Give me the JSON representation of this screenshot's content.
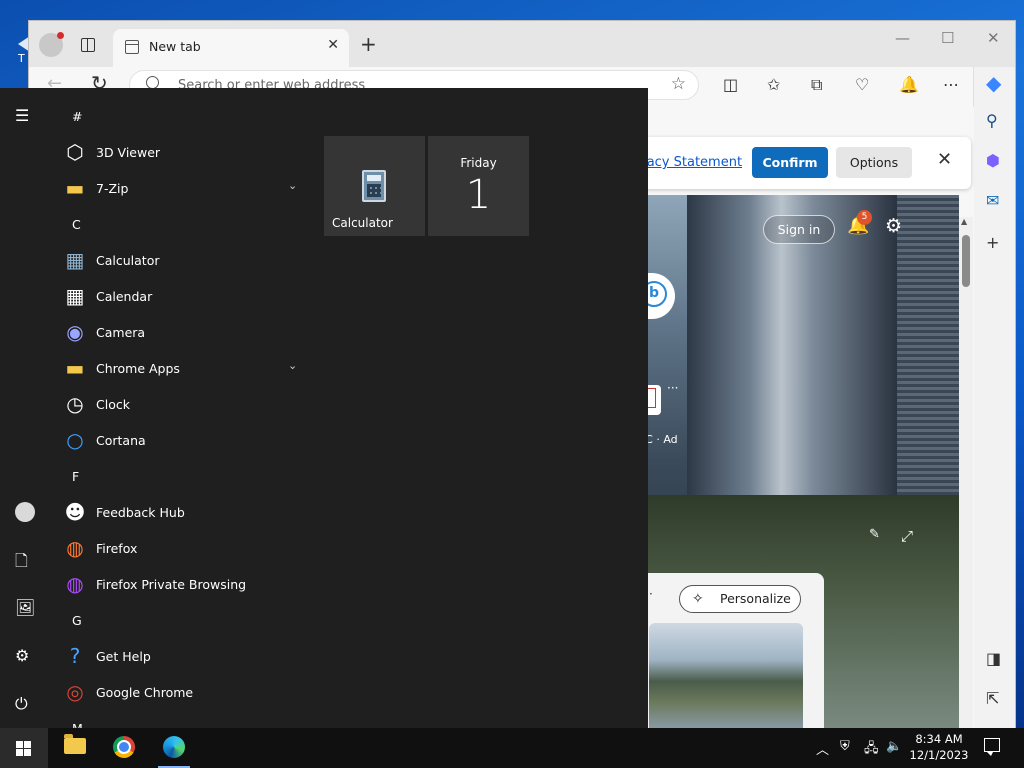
{
  "desktop": {
    "icon_glyph": "T"
  },
  "browser": {
    "tab_title": "New tab",
    "address_placeholder": "Search or enter web address"
  },
  "cookie_banner": {
    "privacy_link": "vacy Statement",
    "confirm_label": "Confirm",
    "options_label": "Options"
  },
  "hero": {
    "sign_in_label": "Sign in",
    "notification_count": "5",
    "ad_label": "QVC · Ad",
    "ad_menu": "···"
  },
  "feed": {
    "personalize_label": "Personalize",
    "menu_dots": "·"
  },
  "start_menu": {
    "groups": [
      {
        "letter": "#",
        "apps": [
          {
            "label": "3D Viewer",
            "icon": "cube-icon"
          },
          {
            "label": "7-Zip",
            "icon": "folder-icon",
            "expandable": true
          }
        ]
      },
      {
        "letter": "C",
        "apps": [
          {
            "label": "Calculator",
            "icon": "calculator-icon"
          },
          {
            "label": "Calendar",
            "icon": "calendar-icon"
          },
          {
            "label": "Camera",
            "icon": "camera-icon"
          },
          {
            "label": "Chrome Apps",
            "icon": "folder-icon",
            "expandable": true
          },
          {
            "label": "Clock",
            "icon": "clock-icon"
          },
          {
            "label": "Cortana",
            "icon": "cortana-icon"
          }
        ]
      },
      {
        "letter": "F",
        "apps": [
          {
            "label": "Feedback Hub",
            "icon": "feedback-icon"
          },
          {
            "label": "Firefox",
            "icon": "firefox-icon"
          },
          {
            "label": "Firefox Private Browsing",
            "icon": "firefox-private-icon"
          }
        ]
      },
      {
        "letter": "G",
        "apps": [
          {
            "label": "Get Help",
            "icon": "help-icon"
          },
          {
            "label": "Google Chrome",
            "icon": "chrome-icon"
          }
        ]
      },
      {
        "letter": "M",
        "apps": []
      }
    ],
    "tiles": {
      "calculator_label": "Calculator",
      "calendar_day": "Friday",
      "calendar_date": "1"
    }
  },
  "taskbar": {
    "time": "8:34 AM",
    "date": "12/1/2023"
  }
}
